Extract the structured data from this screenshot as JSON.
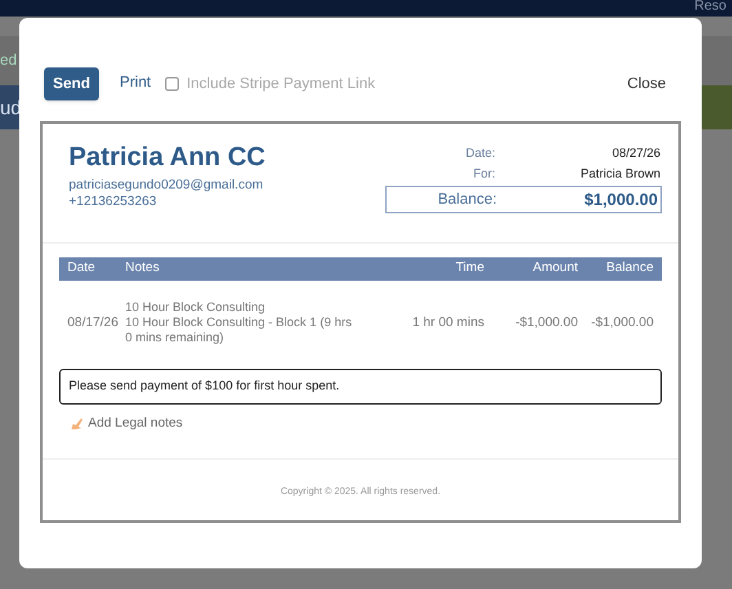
{
  "background": {
    "header_text": "Reso",
    "side_texts": [
      "ed",
      "ud"
    ]
  },
  "toolbar": {
    "send": "Send",
    "print": "Print",
    "stripe": {
      "label": "Include Stripe Payment Link",
      "checked": false
    },
    "close": "Close"
  },
  "invoice": {
    "name": "Patricia Ann CC",
    "email": "patriciasegundo0209@gmail.com",
    "phone": "+12136253263",
    "meta": [
      {
        "label": "Date:",
        "value": "08/27/26"
      },
      {
        "label": "For:",
        "value": "Patricia Brown"
      }
    ],
    "balance": {
      "label": "Balance:",
      "value": "$1,000.00"
    },
    "table": {
      "columns": [
        "Date",
        "Notes",
        "Time",
        "Amount",
        "Balance"
      ],
      "rows": [
        {
          "date": "08/17/26",
          "notes": [
            "10 Hour Block Consulting",
            "10 Hour Block Consulting - Block 1 (9 hrs 0 mins remaining)"
          ],
          "time": "1 hr 00 mins",
          "amount": "-$1,000.00",
          "balance": "-$1,000.00"
        }
      ]
    },
    "note": "Please send payment of $100 for first hour spent.",
    "legal_link": "Add Legal notes",
    "footer": "Copyright © 2025. All rights reserved."
  }
}
